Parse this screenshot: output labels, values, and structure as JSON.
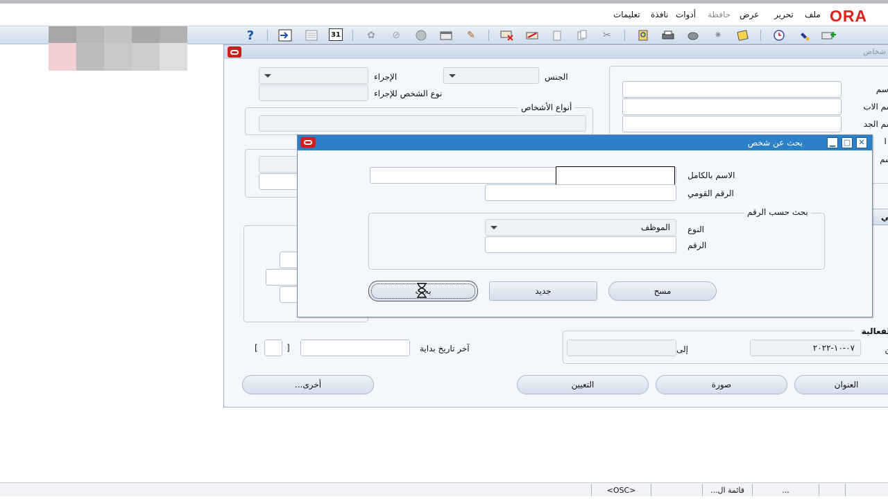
{
  "app": {
    "logo_text": "ORA"
  },
  "menu": {
    "items": [
      {
        "label": "ملف"
      },
      {
        "label": "تحرير"
      },
      {
        "label": "عرض"
      },
      {
        "label": "حافظة"
      },
      {
        "label": "أدوات"
      },
      {
        "label": "نافذة"
      },
      {
        "label": "تعليمات"
      }
    ]
  },
  "toolbar": {
    "icons": [
      "help-icon",
      "navigate-icon",
      "summary-icon",
      "calendar-icon",
      "folder-tools-icon",
      "attach-icon",
      "globe-icon",
      "window-icon",
      "edit-icon",
      "clear-record-icon",
      "delete-icon",
      "copy-icon",
      "paste-icon",
      "cut-icon",
      "find-icon",
      "print-icon",
      "zoom-icon",
      "export-icon",
      "notes-icon",
      "clock-icon",
      "flashlight-icon",
      "new-icon"
    ],
    "help_glyph": "?",
    "calendar_day": "31"
  },
  "main": {
    "title_partial": "شخاص",
    "name_label": "الاسم",
    "father_name_label": "اسم الاب",
    "grandfather_name_label": "اسم الجد",
    "partial_label_1": "ب ا",
    "partial_label_2": "لاسم",
    "gender_label": "الجنس",
    "action_label": "الإجراء",
    "person_type_for_action_label": "نوع الشخص للإجراء",
    "person_types_label": "أنواع الأشخاص",
    "partial_tab_label": "سمي",
    "validity_label": "الفعالية",
    "from_label": "من",
    "from_value": "٠٧-١٠-٢٠٢٢",
    "to_label": "إلى",
    "last_start_date_label": "آخر تاريخ بداية",
    "bracket_open": "[",
    "bracket_close": "]",
    "buttons": {
      "address": "العنوان",
      "picture": "صورة",
      "assignment": "التعيين",
      "others": "أخرى..."
    }
  },
  "dialog": {
    "title": "بحث عن شخص",
    "full_name_label": "الاسم بالكامل",
    "national_id_label": "الرقم القومي",
    "search_by_number_label": "بحث حسب الرقم",
    "type_label": "النوع",
    "type_value": "الموظف",
    "number_label": "الرقم",
    "buttons": {
      "find": "بحث",
      "new": "جديد",
      "clear": "مسح"
    }
  },
  "status": {
    "cells": [
      "<OSC>",
      "قائمة ال...",
      "..."
    ]
  }
}
